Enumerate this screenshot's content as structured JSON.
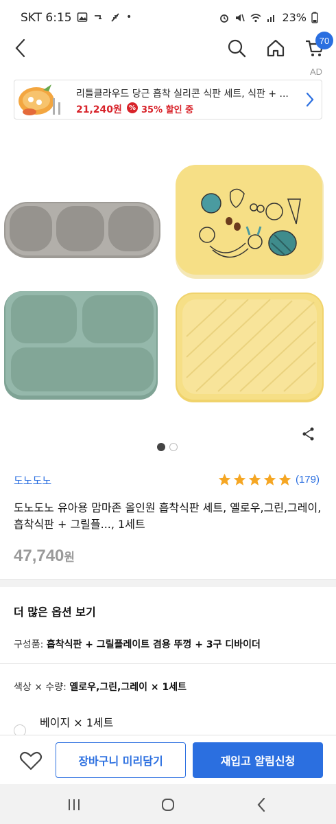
{
  "status_bar": {
    "carrier_time": "SKT 6:15",
    "dot": "•",
    "battery": "23%"
  },
  "topnav": {
    "cart_count": "70",
    "ad_label": "AD"
  },
  "ad": {
    "title": "리틀클라우드 당근 흡착 실리콘 식판 세트, 식판 + ...",
    "price": "21,240원",
    "discount_icon": "%",
    "discount": "35% 할인 중"
  },
  "product": {
    "brand": "도노도노",
    "rating_count": "(179)",
    "rating_stars": 5,
    "title": "도노도노 유아용 맘마존 올인원 흡착식판 세트, 옐로우,그린,그레이, 흡착식판 + 그릴플..., 1세트",
    "price_value": "47,740",
    "price_unit": "원",
    "image_page": 1,
    "image_total": 2
  },
  "options": {
    "section_title": "더 많은 옵션 보기",
    "composition_label": "구성품: ",
    "composition_value": "흡착식판 + 그릴플레이트 겸용 뚜껑 + 3구 디바이더",
    "color_label": "색상 × 수량: ",
    "color_value": "옐로우,그린,그레이 × 1세트",
    "alt_option": "베이지 × 1세트"
  },
  "bottom": {
    "cart_button": "장바구니 미리담기",
    "restock_button": "재입고 알림신청"
  },
  "colors": {
    "accent": "#2b6fe0",
    "sale": "#d8232a",
    "yellow_plate": "#f6df86",
    "green_plate": "#8fb3a5",
    "gray_plate": "#a9a6a1"
  }
}
